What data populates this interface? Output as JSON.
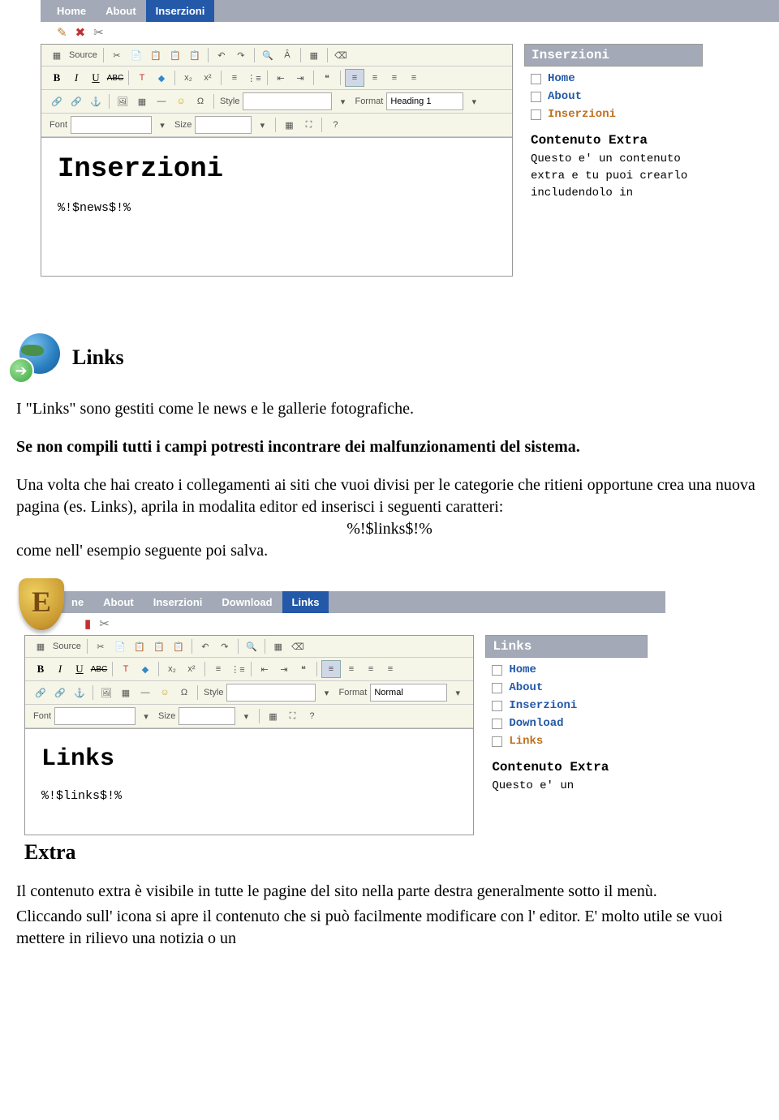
{
  "shot1": {
    "nav": [
      "Home",
      "About",
      "Inserzioni"
    ],
    "nav_active": 2,
    "toolbar": {
      "source": "Source",
      "style": "Style",
      "format_lbl": "Format",
      "format_val": "Heading 1",
      "font": "Font",
      "size": "Size"
    },
    "content_heading": "Inserzioni",
    "content_code": "%!$news$!%",
    "sidebar_title": "Inserzioni",
    "sidebar_items": [
      {
        "label": "Home",
        "color": "blue"
      },
      {
        "label": "About",
        "color": "blue"
      },
      {
        "label": "Inserzioni",
        "color": "orange"
      }
    ],
    "extra_title": "Contenuto Extra",
    "extra_body": "Questo e' un contenuto extra e tu puoi crearlo includendolo in"
  },
  "links_section": {
    "heading": "Links",
    "p1": "I \"Links\" sono gestiti come le news e le gallerie fotografiche.",
    "p2": "Se non compili tutti i campi potresti incontrare dei malfunzionamenti del sistema.",
    "p3": "Una volta che hai creato i collegamenti ai siti che vuoi divisi per le categorie che ritieni opportune crea una nuova pagina (es. Links), aprila in modalita editor ed inserisci i seguenti caratteri:",
    "code": "%!$links$!%",
    "p4": "come nell' esempio seguente poi salva."
  },
  "shot2": {
    "nav": [
      "ne",
      "About",
      "Inserzioni",
      "Download",
      "Links"
    ],
    "nav_active": 4,
    "toolbar": {
      "source": "Source",
      "style": "Style",
      "format_lbl": "Format",
      "format_val": "Normal",
      "font": "Font",
      "size": "Size"
    },
    "content_heading": "Links",
    "content_code": "%!$links$!%",
    "sidebar_title": "Links",
    "sidebar_items": [
      {
        "label": "Home",
        "color": "blue"
      },
      {
        "label": "About",
        "color": "blue"
      },
      {
        "label": "Inserzioni",
        "color": "blue"
      },
      {
        "label": "Download",
        "color": "blue"
      },
      {
        "label": "Links",
        "color": "orange"
      }
    ],
    "extra_title": "Contenuto Extra",
    "extra_body": "Questo e' un"
  },
  "extra_section": {
    "heading": "Extra",
    "p1": "Il contenuto extra è visibile in tutte le pagine del sito nella parte destra generalmente sotto il menù.",
    "p2": "Cliccando sull' icona si apre il contenuto che si può facilmente modificare con l' editor. E' molto utile se vuoi mettere in rilievo una notizia o un"
  }
}
